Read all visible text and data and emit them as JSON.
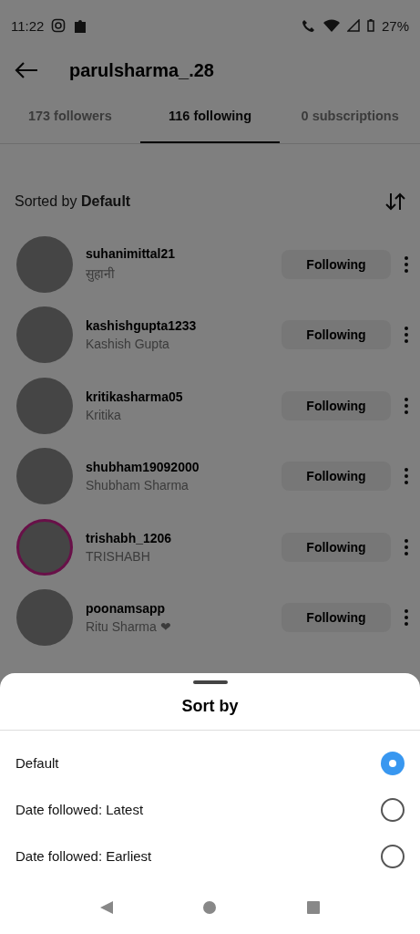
{
  "status_bar": {
    "time": "11:22",
    "battery": "27%"
  },
  "header": {
    "title": "parulsharma_.28"
  },
  "tabs": [
    {
      "label": "173 followers",
      "selected": false
    },
    {
      "label": "116 following",
      "selected": true
    },
    {
      "label": "0 subscriptions",
      "selected": false
    }
  ],
  "sort_line": "Sorted by **Default**",
  "accounts": [
    {
      "username": "suhanimittal21",
      "name": "सुहानी",
      "story": false,
      "button": "Following"
    },
    {
      "username": "kashishgupta1233",
      "name": "Kashish Gupta",
      "story": false,
      "button": "Following"
    },
    {
      "username": "kritikasharma05",
      "name": "Kritika",
      "story": false,
      "button": "Following"
    },
    {
      "username": "shubham19092000",
      "name": "Shubham Sharma",
      "story": false,
      "button": "Following"
    },
    {
      "username": "trishabh_1206",
      "name": "TRISHABH",
      "story": true,
      "button": "Following"
    },
    {
      "username": "poonamsapp",
      "name": "Ritu Sharma ❤",
      "story": false,
      "button": "Following"
    }
  ],
  "sheet": {
    "title": "Sort by",
    "options": [
      {
        "label": "Default",
        "selected": true
      },
      {
        "label": "Date followed: Latest",
        "selected": false
      },
      {
        "label": "Date followed: Earliest",
        "selected": false
      }
    ]
  }
}
